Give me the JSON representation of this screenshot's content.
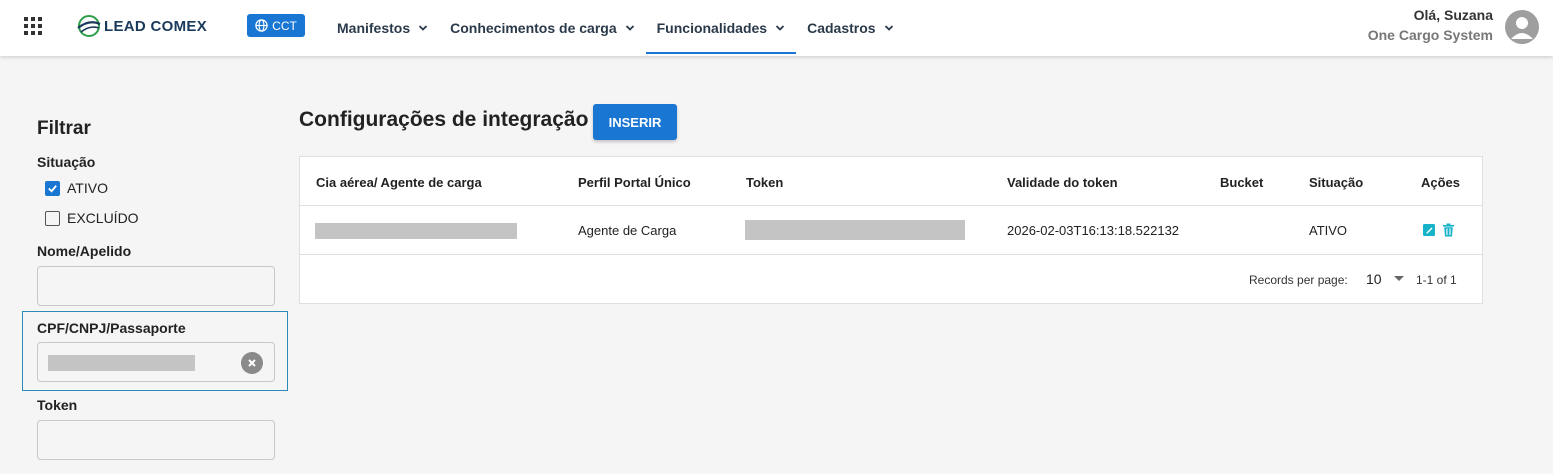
{
  "header": {
    "logo_text": "LEAD COMEX",
    "badge_label": "CCT",
    "nav": [
      {
        "label": "Manifestos"
      },
      {
        "label": "Conhecimentos de carga"
      },
      {
        "label": "Funcionalidades",
        "active": true
      },
      {
        "label": "Cadastros"
      }
    ],
    "user_greeting": "Olá, Suzana",
    "user_system": "One Cargo System"
  },
  "filter": {
    "title": "Filtrar",
    "situacao_label": "Situação",
    "options": [
      {
        "label": "ATIVO",
        "checked": true
      },
      {
        "label": "EXCLUÍDO",
        "checked": false
      }
    ],
    "nome_label": "Nome/Apelido",
    "nome_value": "",
    "cpf_label": "CPF/CNPJ/Passaporte",
    "token_label": "Token",
    "token_value": ""
  },
  "main": {
    "title": "Configurações de integração",
    "insert_label": "INSERIR",
    "columns": [
      "Cia aérea/ Agente de carga",
      "Perfil Portal Único",
      "Token",
      "Validade do token",
      "Bucket",
      "Situação",
      "Ações"
    ],
    "rows": [
      {
        "perfil": "Agente de Carga",
        "validade": "2026-02-03T16:13:18.522132",
        "bucket": "",
        "situacao": "ATIVO"
      }
    ],
    "pagination": {
      "records_label": "Records per page:",
      "per_page": "10",
      "range": "1-1 of 1"
    }
  },
  "colors": {
    "accent": "#1976d2",
    "action_icon": "#17b3c9"
  }
}
